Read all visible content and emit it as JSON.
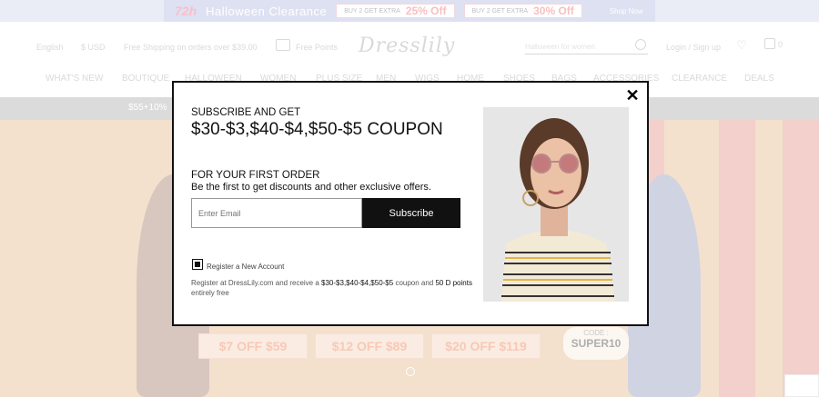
{
  "promo_banner": {
    "badge": "72h",
    "title": "Halloween Clearance",
    "offers": [
      {
        "small": "BUY 2 GET EXTRA",
        "big": "25% Off"
      },
      {
        "small": "BUY 2 GET EXTRA",
        "big": "30% Off"
      }
    ],
    "shop_now": "Shop Now"
  },
  "header": {
    "language": "English",
    "currency": "$ USD",
    "shipping": "Free Shipping on orders over $39.00",
    "free_points": "Free Points",
    "logo": "Dresslily",
    "search_placeholder": "Halloween for women",
    "login": "Login / Sign up",
    "cart_count": "0"
  },
  "nav": [
    "WHAT'S NEW",
    "BOUTIQUE",
    "HALLOWEEN",
    "WOMEN",
    "PLUS SIZE",
    "MEN",
    "WIGS",
    "HOME",
    "SHOES",
    "BAGS",
    "ACCESSORIES",
    "CLEARANCE",
    "DEALS"
  ],
  "gray_bar": {
    "text": "$55+10%"
  },
  "hero": {
    "coupons": [
      "$7 OFF $59",
      "$12 OFF $89",
      "$20 OFF $119"
    ],
    "code_label": "CODE :",
    "code_value": "SUPER10"
  },
  "modal": {
    "subscribe_heading": "SUBSCRIBE AND GET",
    "coupon_text": "$30-$3,$40-$4,$50-$5 COUPON",
    "first_order": "FOR YOUR FIRST ORDER",
    "first_offers": "Be the first to get discounts and other exclusive offers.",
    "email_placeholder": "Enter Email",
    "subscribe_button": "Subscribe",
    "register_label": "Register a New Account",
    "note_prefix": "Register at DressLily.com and receive a ",
    "note_coupon": "$30-$3,$40-$4,$50-$5",
    "note_mid": " coupon and ",
    "note_points": "50 D points",
    "note_suffix": " entirely free",
    "register_checked": true
  },
  "colors": {
    "accent": "#111111",
    "banner": "#c3c8e8",
    "coupon": "#f29b7a"
  }
}
